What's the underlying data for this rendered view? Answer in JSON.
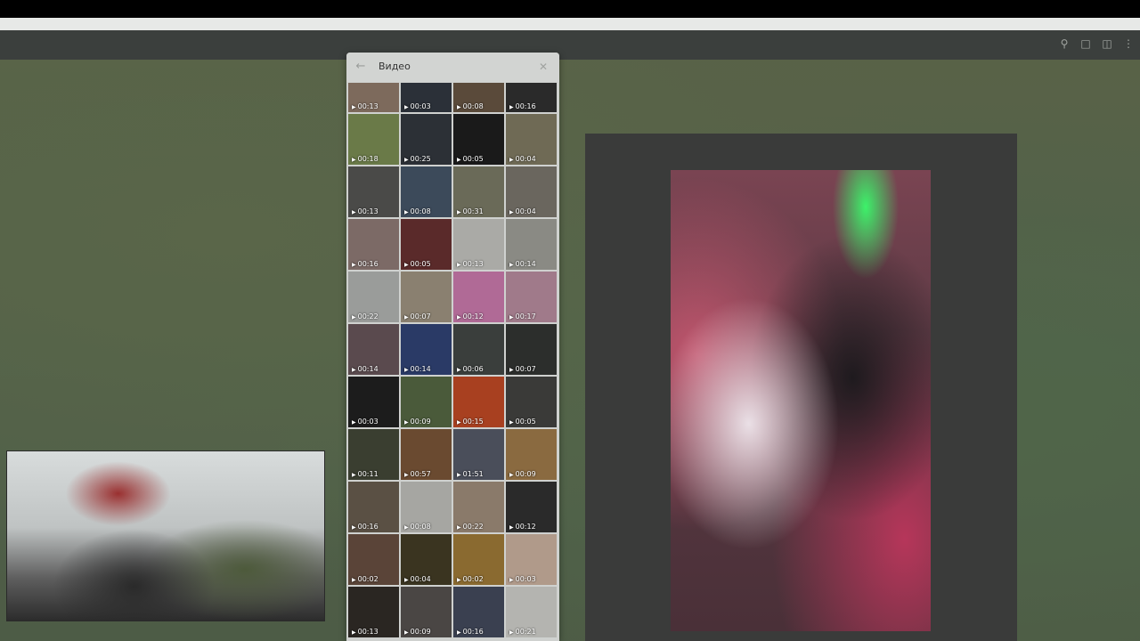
{
  "media_panel": {
    "title": "Видео",
    "back_icon": "arrow-left-icon",
    "close_icon": "close-icon"
  },
  "thumbnails": [
    {
      "duration": "00:13",
      "color": "#7d6a5c"
    },
    {
      "duration": "00:03",
      "color": "#2b3038"
    },
    {
      "duration": "00:08",
      "color": "#5a4a3a"
    },
    {
      "duration": "00:16",
      "color": "#2a2a2a"
    },
    {
      "duration": "00:18",
      "color": "#6a7a48"
    },
    {
      "duration": "00:25",
      "color": "#2c3036"
    },
    {
      "duration": "00:05",
      "color": "#1a1a1a"
    },
    {
      "duration": "00:04",
      "color": "#6f6a55"
    },
    {
      "duration": "00:13",
      "color": "#4a4a48"
    },
    {
      "duration": "00:08",
      "color": "#3c4a5a"
    },
    {
      "duration": "00:31",
      "color": "#6a6a58"
    },
    {
      "duration": "00:04",
      "color": "#6a665e"
    },
    {
      "duration": "00:16",
      "color": "#7c6a66"
    },
    {
      "duration": "00:05",
      "color": "#5a2a2a"
    },
    {
      "duration": "00:13",
      "color": "#aaaaa6"
    },
    {
      "duration": "00:14",
      "color": "#8a8a84"
    },
    {
      "duration": "00:22",
      "color": "#9a9c9a"
    },
    {
      "duration": "00:07",
      "color": "#8a8070"
    },
    {
      "duration": "00:12",
      "color": "#b06a96"
    },
    {
      "duration": "00:17",
      "color": "#a07a8a"
    },
    {
      "duration": "00:14",
      "color": "#5a4a4e"
    },
    {
      "duration": "00:14",
      "color": "#2a3a66"
    },
    {
      "duration": "00:06",
      "color": "#3a3e3c"
    },
    {
      "duration": "00:07",
      "color": "#2c2e2c"
    },
    {
      "duration": "00:03",
      "color": "#1c1c1c"
    },
    {
      "duration": "00:09",
      "color": "#4a5a3a"
    },
    {
      "duration": "00:15",
      "color": "#a84020"
    },
    {
      "duration": "00:05",
      "color": "#3a3a38"
    },
    {
      "duration": "00:11",
      "color": "#3a3e30"
    },
    {
      "duration": "00:57",
      "color": "#6a4a30"
    },
    {
      "duration": "01:51",
      "color": "#4a4e5a"
    },
    {
      "duration": "00:09",
      "color": "#8a6a40"
    },
    {
      "duration": "00:16",
      "color": "#5a5044"
    },
    {
      "duration": "00:08",
      "color": "#a6a6a2"
    },
    {
      "duration": "00:22",
      "color": "#8a7a6a"
    },
    {
      "duration": "00:12",
      "color": "#2a2a2a"
    },
    {
      "duration": "00:02",
      "color": "#5a4438"
    },
    {
      "duration": "00:04",
      "color": "#3a3420"
    },
    {
      "duration": "00:02",
      "color": "#8a6a30"
    },
    {
      "duration": "00:03",
      "color": "#b09a8a"
    },
    {
      "duration": "00:13",
      "color": "#2a2622"
    },
    {
      "duration": "00:09",
      "color": "#4a4644"
    },
    {
      "duration": "00:16",
      "color": "#3a4050"
    },
    {
      "duration": "00:21",
      "color": "#b4b4b0"
    }
  ],
  "toolbar": {
    "icons": [
      "search-icon",
      "comments-icon",
      "sidebar-icon",
      "more-icon"
    ]
  }
}
